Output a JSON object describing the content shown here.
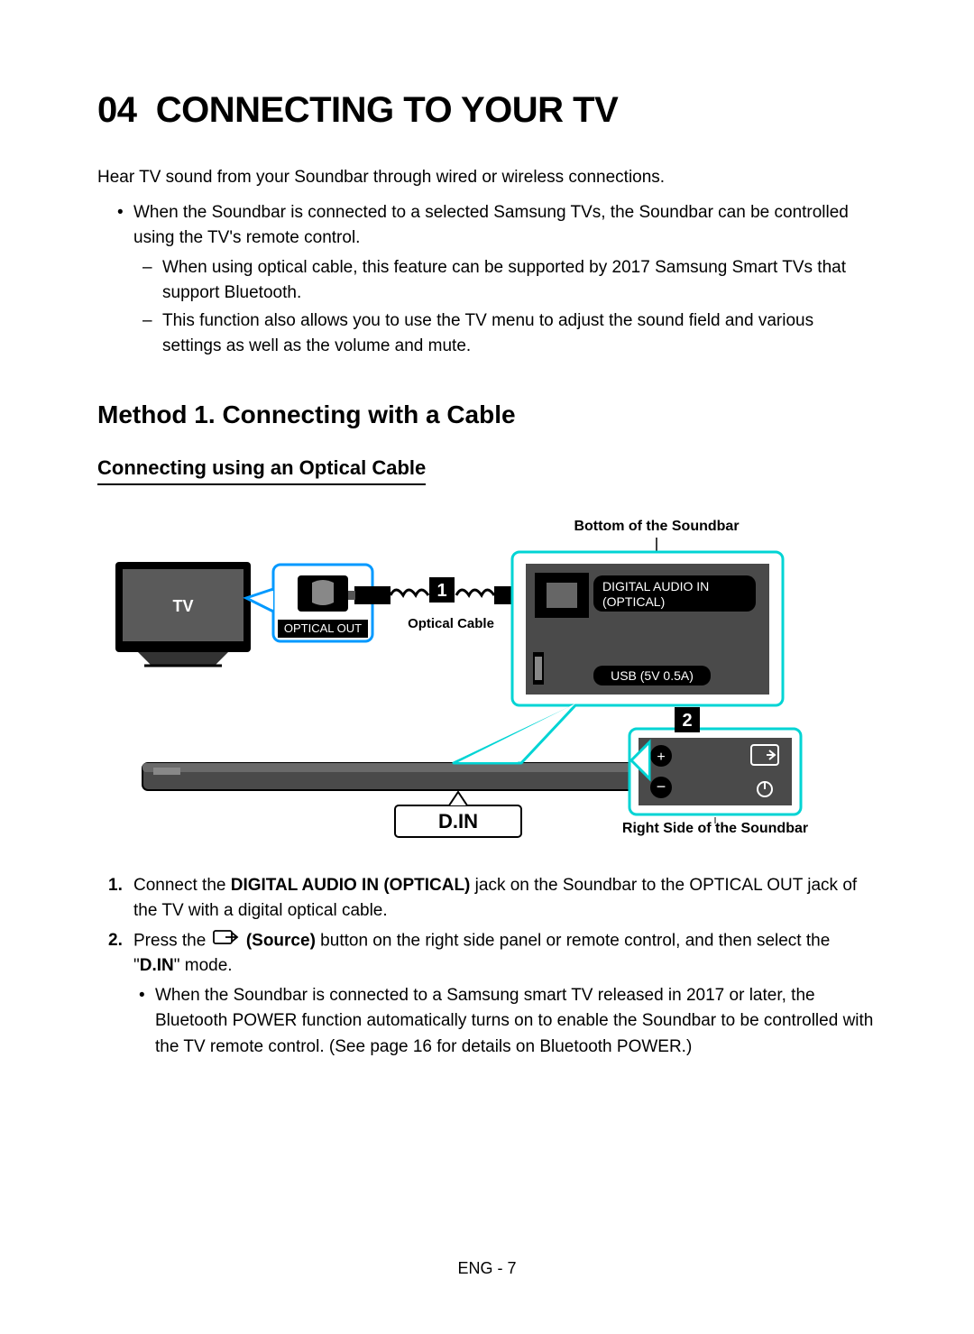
{
  "header": {
    "section_number": "04",
    "section_title": "CONNECTING TO YOUR TV"
  },
  "intro": "Hear TV sound from your Soundbar through wired or wireless connections.",
  "bullets": {
    "main": "When the Soundbar is connected to a selected Samsung TVs, the Soundbar can be controlled using the TV's remote control.",
    "dash1": "When using optical cable, this feature can be supported by 2017 Samsung Smart TVs that support Bluetooth.",
    "dash2": "This function also allows you to use the TV menu to adjust the sound field and various settings as well as the volume and mute."
  },
  "method_title": "Method 1. Connecting with a Cable",
  "sub_title": "Connecting using an Optical Cable",
  "diagram": {
    "top_label": "Bottom of the Soundbar",
    "tv_label": "TV",
    "optical_out": "OPTICAL OUT",
    "cable_label": "Optical Cable",
    "digital_in_line1": "DIGITAL AUDIO IN",
    "digital_in_line2": "(OPTICAL)",
    "usb_label": "USB (5V 0.5A)",
    "callout1": "1",
    "callout2": "2",
    "din_label": "D.IN",
    "right_label": "Right Side of the Soundbar"
  },
  "steps": {
    "s1_a": "Connect the ",
    "s1_b": "DIGITAL AUDIO IN (OPTICAL)",
    "s1_c": " jack on the Soundbar to the OPTICAL OUT jack of the TV with a digital optical cable.",
    "s2_a": "Press the ",
    "s2_b": "(Source)",
    "s2_c": " button on the right side panel or remote control, and then select the \"",
    "s2_d": "D.IN",
    "s2_e": "\" mode.",
    "s2_bullet": "When the Soundbar is connected to a Samsung smart TV released in 2017 or later, the Bluetooth POWER function automatically turns on to enable the Soundbar to be controlled with the TV remote control. (See page 16 for details on Bluetooth POWER.)"
  },
  "footer": "ENG - 7"
}
